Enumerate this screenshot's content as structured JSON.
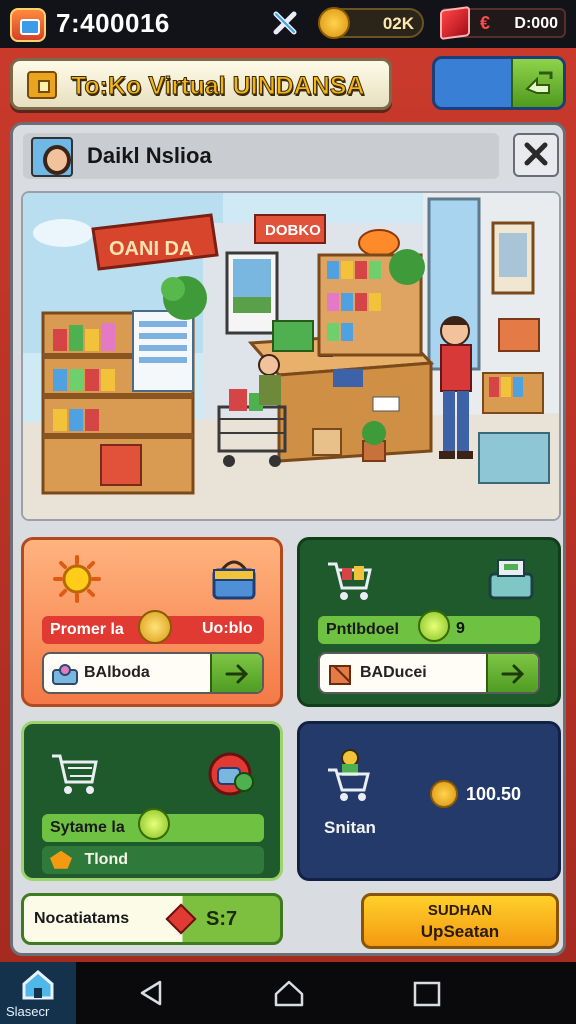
{
  "status_bar": {
    "time": "7:400016",
    "coins": "02K",
    "gem_symbol": "€",
    "gems": "D:000"
  },
  "header": {
    "title": "To:Ko Virtual UINDANSA"
  },
  "panel": {
    "subtitle": "Daikl Nslioa"
  },
  "scene": {
    "sign_left": "OANI DA",
    "sign_center": "DOBKO"
  },
  "cards": {
    "orange": {
      "bar_left": "Promer la",
      "bar_right": "Uo:blo",
      "button_label": "BAlboda"
    },
    "green": {
      "bar_label": "Pntlbdoel",
      "bar_value": "9",
      "button_label": "BADucei"
    },
    "dark_green": {
      "bar_label": "Sytame la",
      "second_label": "Tlond"
    },
    "navy": {
      "label": "Snitan",
      "value": "100.50"
    }
  },
  "bottom": {
    "left_label": "Nocatiatams",
    "left_value": "S:7",
    "right_line1": "SUDHAN",
    "right_line2": "UpSeatan"
  },
  "nav": {
    "home_label": "Slasecr"
  },
  "colors": {
    "frame": "#c93a2b",
    "panel": "#d9dde2",
    "accent_green": "#5aa82a",
    "accent_orange": "#f47a47",
    "accent_navy": "#243a6a",
    "gold": "#f3b515"
  }
}
